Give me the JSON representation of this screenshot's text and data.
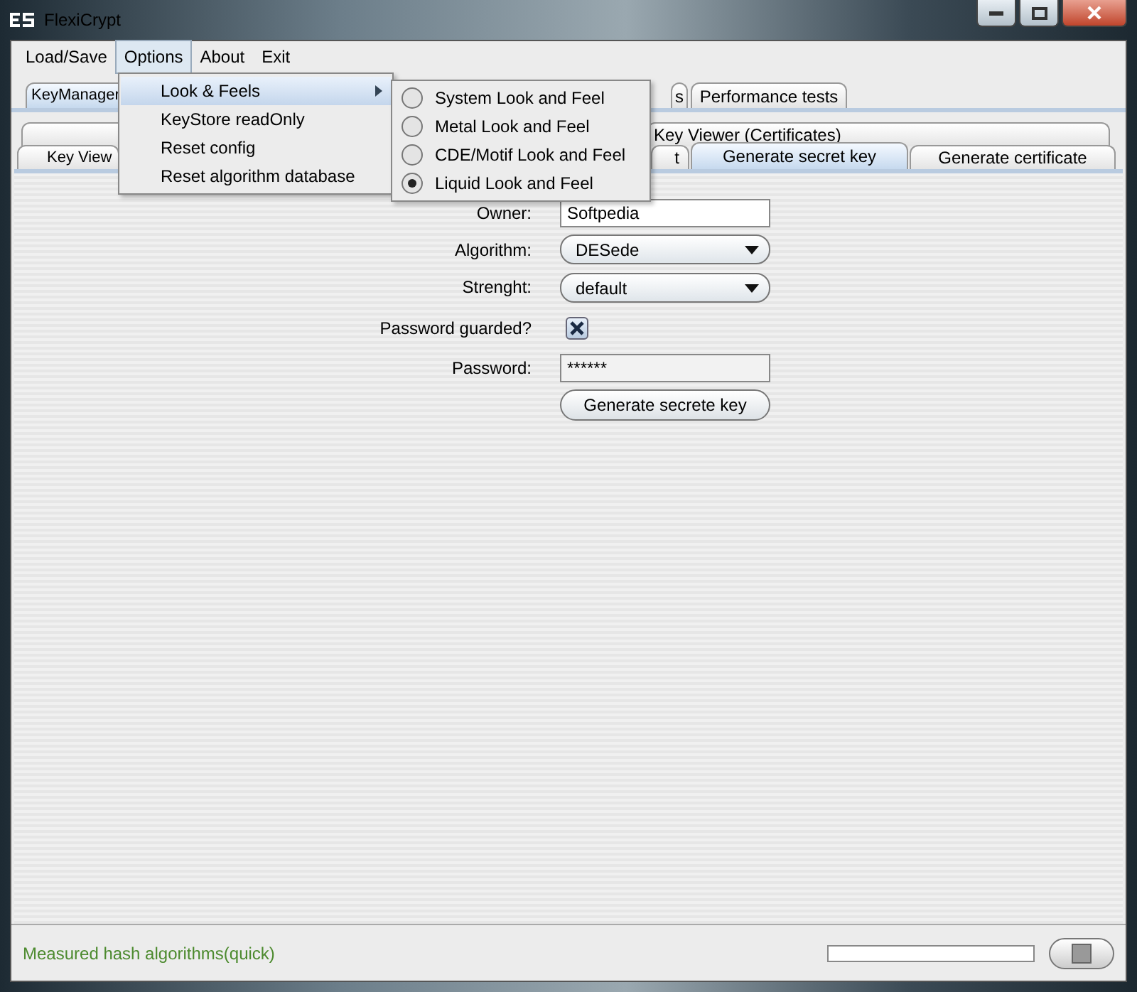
{
  "window": {
    "title": "FlexiCrypt"
  },
  "menu_bar": [
    {
      "label": "Load/Save",
      "selected": false
    },
    {
      "label": "Options",
      "selected": true
    },
    {
      "label": "About",
      "selected": false
    },
    {
      "label": "Exit",
      "selected": false
    }
  ],
  "options_menu": [
    {
      "label": "Look & Feels",
      "selected": true,
      "submenu": true
    },
    {
      "label": "KeyStore readOnly",
      "selected": false,
      "submenu": false
    },
    {
      "label": "Reset config",
      "selected": false,
      "submenu": false
    },
    {
      "label": "Reset algorithm database",
      "selected": false,
      "submenu": false
    }
  ],
  "look_and_feels": [
    {
      "label": "System Look and Feel",
      "selected": false
    },
    {
      "label": "Metal Look and Feel",
      "selected": false
    },
    {
      "label": "CDE/Motif Look and Feel",
      "selected": false
    },
    {
      "label": "Liquid Look and Feel",
      "selected": true
    }
  ],
  "tabs": [
    {
      "label": "KeyManager",
      "selected": true
    },
    {
      "label": "s",
      "selected": false
    },
    {
      "label": "Performance tests",
      "selected": false
    }
  ],
  "subtabs_row_1": [
    {
      "selected": false
    },
    {
      "label": "Key Viewer (Certificates)",
      "selected": false
    }
  ],
  "subtabs_row_2": [
    {
      "label": "Key View",
      "selected": false
    },
    {
      "label": "t",
      "selected": false
    },
    {
      "label": "Generate secret key",
      "selected": true
    },
    {
      "label": "Generate certificate",
      "selected": false
    }
  ],
  "form": {
    "owner": {
      "label": "Owner:",
      "value": "Softpedia"
    },
    "algorithm": {
      "label": "Algorithm:",
      "value": "DESede"
    },
    "strength": {
      "label": "Strenght:",
      "value": "default"
    },
    "password_guarded": {
      "label": "Password guarded?",
      "checked": true
    },
    "password": {
      "label": "Password:",
      "value": "******"
    },
    "button": "Generate secrete key"
  },
  "status_bar": {
    "message": "Measured hash algorithms(quick)",
    "progress": {
      "level": 0
    }
  }
}
